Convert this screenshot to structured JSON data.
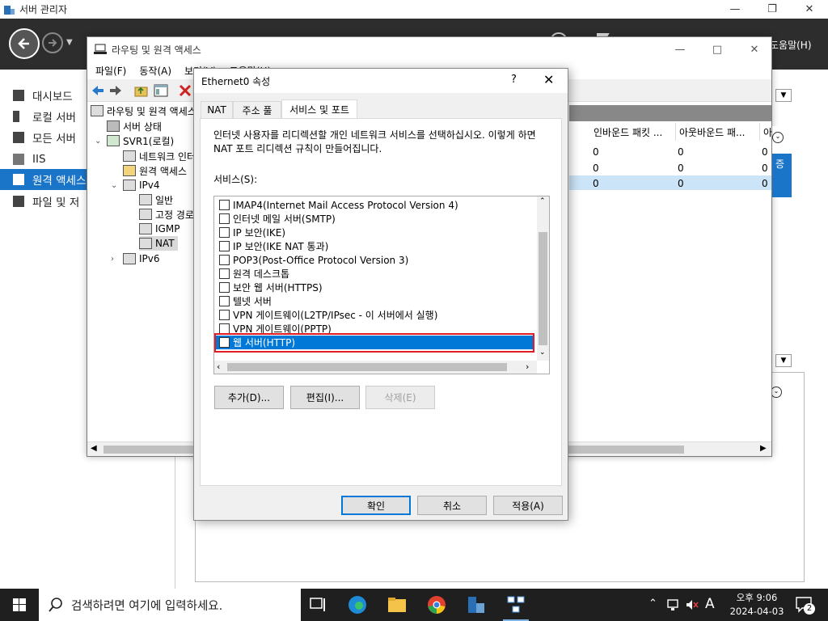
{
  "server_manager": {
    "title": "서버 관리자",
    "help": "도움말(H)",
    "nav": [
      "대시보드",
      "로컬 서버",
      "모든 서버",
      "IIS",
      "원격 액세스",
      "파일 및 저"
    ]
  },
  "rras": {
    "title": "라우팅 및 원격 액세스",
    "menu": [
      "파일(F)",
      "동작(A)",
      "보기(V)",
      "도움말(H)"
    ],
    "tree": {
      "root": "라우팅 및 원격 액세스",
      "server_status": "서버 상태",
      "server": "SVR1(로컬)",
      "network_interfaces": "네트워크 인터",
      "remote_access": "원격 액세스",
      "ipv4": "IPv4",
      "general": "일반",
      "static_routes": "고정 경로",
      "igmp": "IGMP",
      "nat": "NAT",
      "ipv6": "IPv6"
    },
    "list": {
      "columns": [
        "인바운드 패킷 ...",
        "아웃바운드 패...",
        "아"
      ],
      "rows": [
        [
          "0",
          "0",
          "0"
        ],
        [
          "0",
          "0",
          "0"
        ],
        [
          "0",
          "0",
          "0"
        ]
      ],
      "side_label": "증"
    }
  },
  "dialog": {
    "title": "Ethernet0 속성",
    "help": "?",
    "tabs": [
      "NAT",
      "주소 풀",
      "서비스 및 포트"
    ],
    "description": "인터넷 사용자를 리디렉션할 개인 네트워크 서비스를 선택하십시오. 이렇게 하면 NAT 포트 리디렉션 규칙이 만들어집니다.",
    "services_label": "서비스(S):",
    "services": [
      "IMAP4(Internet Mail Access Protocol Version 4)",
      "인터넷 메일 서버(SMTP)",
      "IP 보안(IKE)",
      "IP 보안(IKE NAT 통과)",
      "POP3(Post-Office Protocol Version 3)",
      "원격 데스크톱",
      "보안 웹 서버(HTTPS)",
      "텔넷 서버",
      "VPN 게이트웨이(L2TP/IPsec - 이 서버에서 실행)",
      "VPN 게이트웨이(PPTP)",
      "웹 서버(HTTP)"
    ],
    "selected_service": "웹 서버(HTTP)",
    "buttons": {
      "add": "추가(D)...",
      "edit": "편집(I)...",
      "delete": "삭제(E)"
    },
    "footer": {
      "ok": "확인",
      "cancel": "취소",
      "apply": "적용(A)"
    }
  },
  "taskbar": {
    "search_placeholder": "검색하려면 여기에 입력하세요.",
    "ime": "A",
    "time": "오후 9:06",
    "date": "2024-04-03",
    "notifications": "2"
  }
}
